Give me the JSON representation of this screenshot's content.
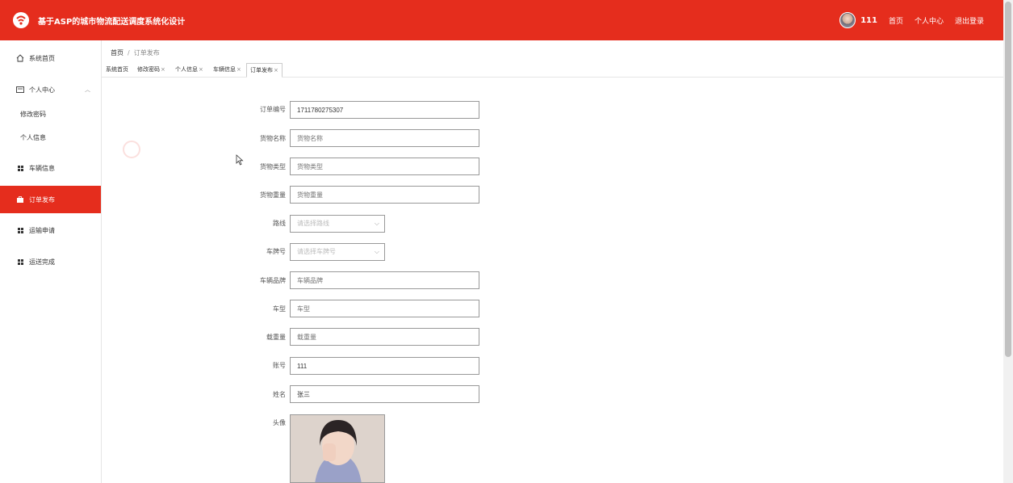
{
  "header": {
    "app_title": "基于ASP的城市物流配送调度系统化设计",
    "username": "111",
    "links": [
      "首页",
      "个人中心",
      "退出登录"
    ]
  },
  "sidebar": {
    "items": [
      {
        "label": "系统首页",
        "icon": "home-icon"
      },
      {
        "label": "个人中心",
        "icon": "profile-card-icon"
      },
      {
        "label": "修改密码"
      },
      {
        "label": "个人信息"
      },
      {
        "label": "车辆信息",
        "icon": "grid-icon"
      },
      {
        "label": "订单发布",
        "icon": "briefcase-icon"
      },
      {
        "label": "运输申请",
        "icon": "grid-icon"
      },
      {
        "label": "运送完成",
        "icon": "grid-icon"
      }
    ]
  },
  "breadcrumb": {
    "home": "首页",
    "separator": "/",
    "current": "订单发布"
  },
  "tabs": [
    {
      "label": "系统首页",
      "closable": false
    },
    {
      "label": "修改密码",
      "closable": true
    },
    {
      "label": "个人信息",
      "closable": true
    },
    {
      "label": "车辆信息",
      "closable": true
    },
    {
      "label": "订单发布",
      "closable": true
    }
  ],
  "form": {
    "fields": [
      {
        "label": "订单编号",
        "value": "1711780275307",
        "placeholder": ""
      },
      {
        "label": "货物名称",
        "value": "",
        "placeholder": "货物名称"
      },
      {
        "label": "货物类型",
        "value": "",
        "placeholder": "货物类型"
      },
      {
        "label": "货物重量",
        "value": "",
        "placeholder": "货物重量"
      },
      {
        "label": "路线",
        "value": "",
        "placeholder": "请选择路线",
        "type": "select"
      },
      {
        "label": "车牌号",
        "value": "",
        "placeholder": "请选择车牌号",
        "type": "select"
      },
      {
        "label": "车辆品牌",
        "value": "",
        "placeholder": "车辆品牌"
      },
      {
        "label": "车型",
        "value": "",
        "placeholder": "车型"
      },
      {
        "label": "载重量",
        "value": "",
        "placeholder": "载重量"
      },
      {
        "label": "账号",
        "value": "111",
        "placeholder": ""
      },
      {
        "label": "姓名",
        "value": "张三",
        "placeholder": ""
      },
      {
        "label": "头像",
        "type": "image"
      }
    ]
  },
  "colors": {
    "accent": "#e52d1d"
  }
}
